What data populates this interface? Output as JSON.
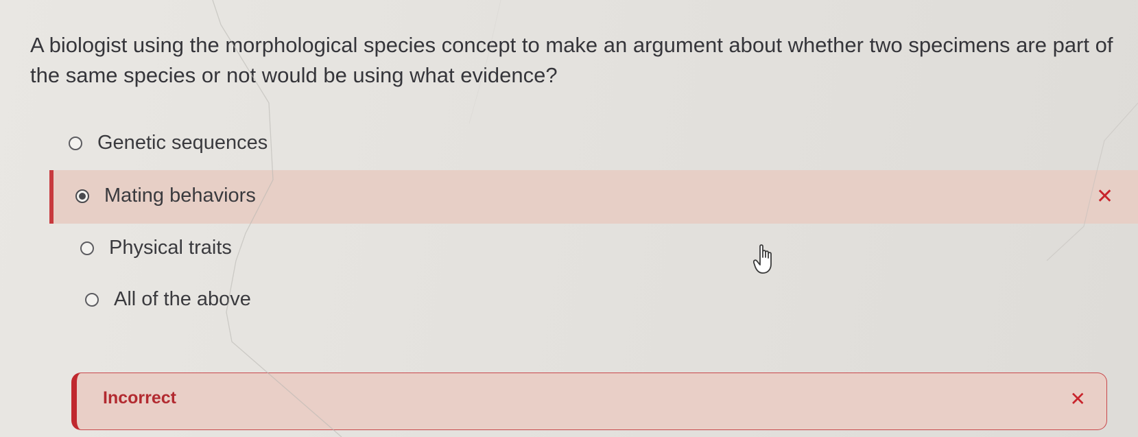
{
  "question": {
    "text": "A biologist using the morphological species concept to make an argument about whether two specimens are part of the same species or not would be using what evidence?"
  },
  "options": [
    {
      "label": "Genetic sequences",
      "selected": false
    },
    {
      "label": "Mating behaviors",
      "selected": true,
      "status": "incorrect"
    },
    {
      "label": "Physical traits",
      "selected": false
    },
    {
      "label": "All of the above",
      "selected": false
    }
  ],
  "feedback": {
    "label": "Incorrect"
  },
  "colors": {
    "incorrect_accent": "#c8242c",
    "incorrect_background": "#e7cfc6"
  },
  "icons": {
    "wrong_mark": "close-icon",
    "cursor": "hand-pointer-icon"
  }
}
